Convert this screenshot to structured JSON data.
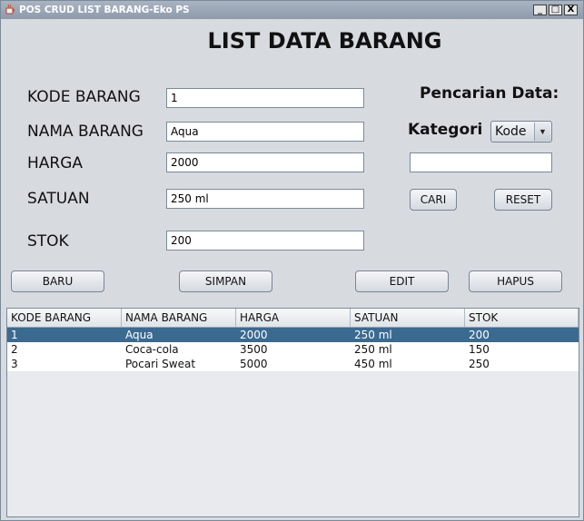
{
  "window": {
    "title": "POS CRUD LIST BARANG-Eko PS",
    "minimize": "_",
    "maximize": "□",
    "close": "X"
  },
  "heading": "LIST DATA BARANG",
  "form": {
    "kode_label": "KODE BARANG",
    "kode_value": "1",
    "nama_label": "NAMA BARANG",
    "nama_value": "Aqua",
    "harga_label": "HARGA",
    "harga_value": "2000",
    "satuan_label": "SATUAN",
    "satuan_value": "250 ml",
    "stok_label": "STOK",
    "stok_value": "200"
  },
  "search": {
    "title": "Pencarian Data:",
    "kategori_label": "Kategori",
    "kategori_value": "Kode",
    "query_value": "",
    "cari_label": "CARI",
    "reset_label": "RESET"
  },
  "actions": {
    "baru": "BARU",
    "simpan": "SIMPAN",
    "edit": "EDIT",
    "hapus": "HAPUS"
  },
  "table": {
    "columns": [
      "KODE BARANG",
      "NAMA BARANG",
      "HARGA",
      "SATUAN",
      "STOK"
    ],
    "rows": [
      [
        "1",
        "Aqua",
        "2000",
        "250 ml",
        "200"
      ],
      [
        "2",
        "Coca-cola",
        "3500",
        "250 ml",
        "150"
      ],
      [
        "3",
        "Pocari Sweat",
        "5000",
        "450 ml",
        "250"
      ]
    ],
    "selected_row": 0
  },
  "colors": {
    "window_bg": "#d7dbe0",
    "titlebar": "#8e9aab",
    "selection": "#3b6a91"
  }
}
